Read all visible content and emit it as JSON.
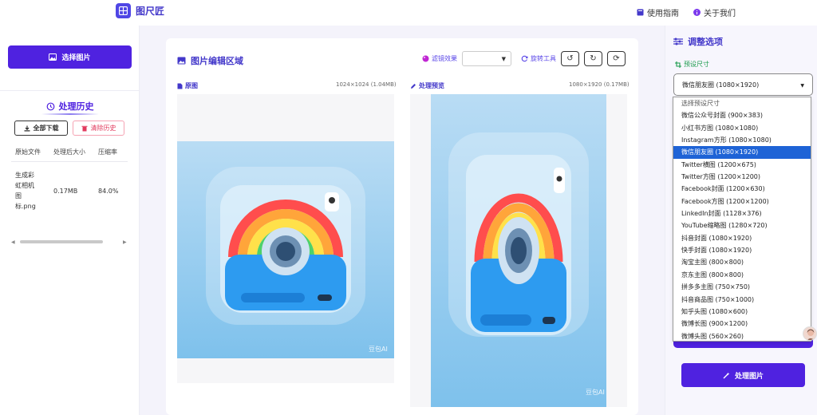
{
  "app": {
    "name": "图尺匠"
  },
  "topnav": {
    "guide": "使用指南",
    "about": "关于我们"
  },
  "left": {
    "select_btn": "选择图片",
    "history_title": "处理历史",
    "download_all": "全部下载",
    "clear_history": "清除历史",
    "table": {
      "headers": [
        "原始文件",
        "处理后大小",
        "压缩率"
      ],
      "rows": [
        {
          "name": "生成彩\n虹相机\n图\n标.png",
          "size": "0.17MB",
          "ratio": "84.0%"
        }
      ]
    }
  },
  "center": {
    "title": "图片编辑区域",
    "filter_label": "滤镜效果",
    "rotate_label": "旋转工具",
    "original_label": "原图",
    "original_dims": "1024×1024 (1.04MB)",
    "preview_label": "处理预览",
    "preview_dims": "1080×1920 (0.17MB)",
    "watermark": "豆包AI"
  },
  "right": {
    "title": "调整选项",
    "preset_label": "预设尺寸",
    "selected": "微信朋友圈 (1080×1920)",
    "options": [
      "选择预设尺寸",
      "微信公众号封面 (900×383)",
      "小红书方图 (1080×1080)",
      "Instagram方形 (1080×1080)",
      "微信朋友圈 (1080×1920)",
      "Twitter横图 (1200×675)",
      "Twitter方图 (1200×1200)",
      "Facebook封面 (1200×630)",
      "Facebook方图 (1200×1200)",
      "LinkedIn封面 (1128×376)",
      "YouTube缩略图 (1280×720)",
      "抖音封面 (1080×1920)",
      "快手封面 (1080×1920)",
      "淘宝主图 (800×800)",
      "京东主图 (800×800)",
      "拼多多主图 (750×750)",
      "抖音商品图 (750×1000)",
      "知乎头图 (1080×600)",
      "微博长图 (900×1200)",
      "微博头图 (560×260)"
    ],
    "process_btn": "处理图片"
  },
  "colors": {
    "brand": "#4f22e0",
    "accent": "#4338ca",
    "selected": "#1e63d6",
    "danger": "#e23a5d",
    "success": "#1a9a4b"
  }
}
